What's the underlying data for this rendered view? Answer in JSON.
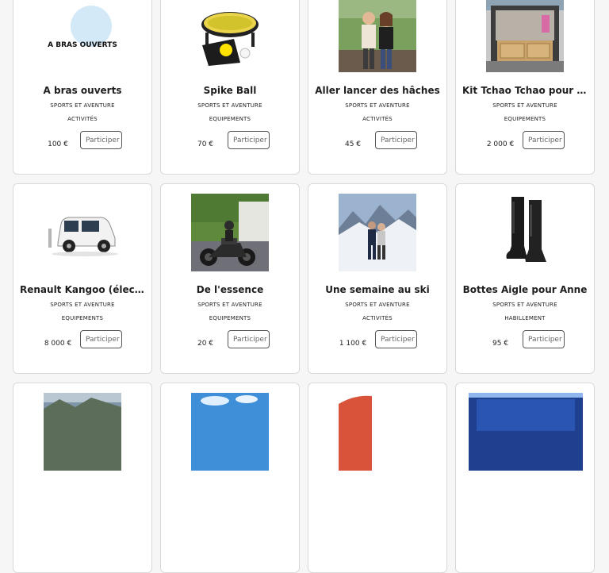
{
  "gifts": [
    {
      "title": "A bras ouverts",
      "category": "SPORTS ET AVENTURE",
      "subcategory": "ACTIVITÉS",
      "price": "100 €",
      "button": "Participer",
      "image_text": "A BRAS OUVERTS",
      "image": "logo-text"
    },
    {
      "title": "Spike Ball",
      "category": "SPORTS ET AVENTURE",
      "subcategory": "EQUIPEMENTS",
      "price": "70 €",
      "button": "Participer",
      "image": "spikeball"
    },
    {
      "title": "Aller lancer des hâches",
      "category": "SPORTS ET AVENTURE",
      "subcategory": "ACTIVITÉS",
      "price": "45 €",
      "button": "Participer",
      "image": "couple"
    },
    {
      "title": "Kit Tchao Tchao pour no…",
      "category": "SPORTS ET AVENTURE",
      "subcategory": "EQUIPEMENTS",
      "price": "2 000 €",
      "button": "Participer",
      "image": "van"
    },
    {
      "title": "Renault Kangoo (électri…",
      "category": "SPORTS ET AVENTURE",
      "subcategory": "EQUIPEMENTS",
      "price": "8 000 €",
      "button": "Participer",
      "image": "car"
    },
    {
      "title": "De l'essence",
      "category": "SPORTS ET AVENTURE",
      "subcategory": "EQUIPEMENTS",
      "price": "20 €",
      "button": "Participer",
      "image": "motorbike"
    },
    {
      "title": "Une semaine au ski",
      "category": "SPORTS ET AVENTURE",
      "subcategory": "ACTIVITÉS",
      "price": "1 100 €",
      "button": "Participer",
      "image": "ski"
    },
    {
      "title": "Bottes Aigle pour Anne",
      "category": "SPORTS ET AVENTURE",
      "subcategory": "HABILLEMENT",
      "price": "95 €",
      "button": "Participer",
      "image": "boots"
    },
    {
      "title": "",
      "category": "",
      "subcategory": "",
      "price": "",
      "button": "",
      "image": "partial-landscape"
    },
    {
      "title": "",
      "category": "",
      "subcategory": "",
      "price": "",
      "button": "",
      "image": "partial-sky"
    },
    {
      "title": "",
      "category": "",
      "subcategory": "",
      "price": "",
      "button": "",
      "image": "partial-orange"
    },
    {
      "title": "",
      "category": "",
      "subcategory": "",
      "price": "",
      "button": "",
      "image": "partial-blue"
    }
  ]
}
